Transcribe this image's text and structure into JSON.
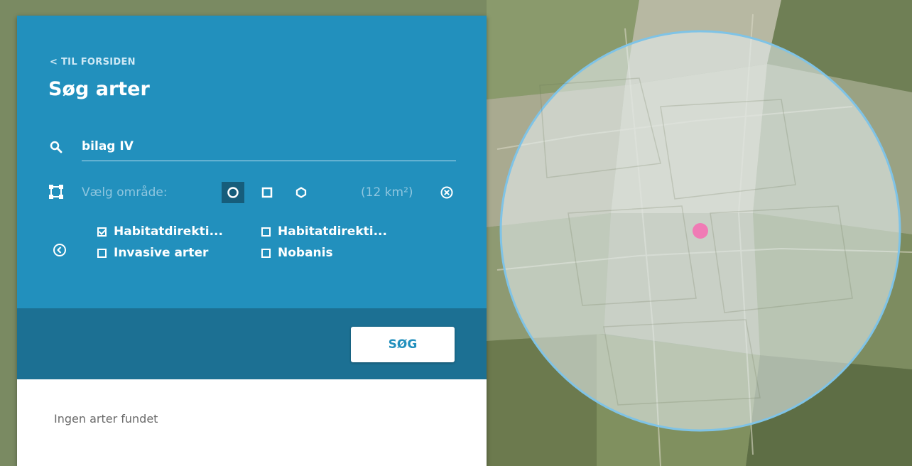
{
  "nav": {
    "back_label": "< TIL FORSIDEN"
  },
  "page": {
    "title": "Søg arter"
  },
  "search": {
    "value": "bilag IV",
    "icon": "search-icon"
  },
  "area": {
    "label": "Vælg område:",
    "shapes": [
      "circle",
      "square",
      "hexagon"
    ],
    "selected_shape": "circle",
    "size": "(12 km²)"
  },
  "filters": [
    {
      "label": "Habitatdirekti...",
      "checked": true
    },
    {
      "label": "Habitatdirekti...",
      "checked": false
    },
    {
      "label": "Invasive arter",
      "checked": false
    },
    {
      "label": "Nobanis",
      "checked": false
    }
  ],
  "actions": {
    "search_label": "SØG"
  },
  "results": {
    "empty_text": "Ingen arter fundet"
  },
  "colors": {
    "panel": "#2290bd",
    "panel_dark": "#1c7093",
    "selection_circle": "#7fc3e6",
    "marker": "#f07bb5"
  }
}
